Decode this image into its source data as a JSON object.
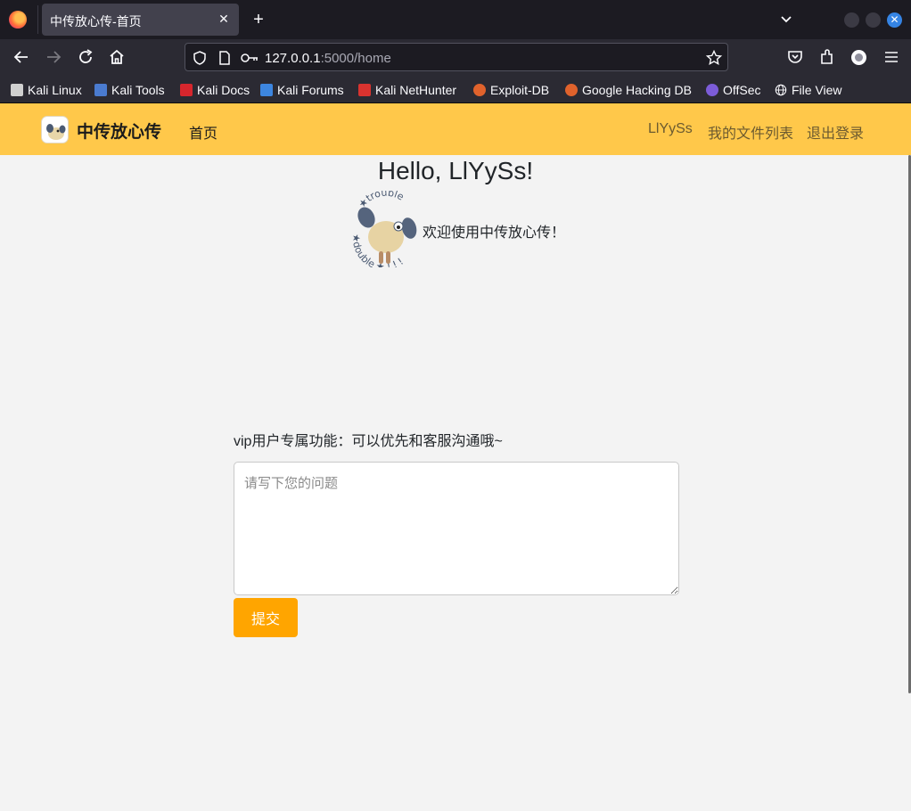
{
  "browser": {
    "tab_title": "中传放心传-首页",
    "url_host": "127.0.0.1",
    "url_path": ":5000/home",
    "bookmarks": [
      {
        "label": "Kali Linux",
        "color": "#367bf0"
      },
      {
        "label": "Kali Tools",
        "color": "#4a7bd0"
      },
      {
        "label": "Kali Docs",
        "color": "#d6262d"
      },
      {
        "label": "Kali Forums",
        "color": "#3d86e0"
      },
      {
        "label": "Kali NetHunter",
        "color": "#d9332f"
      },
      {
        "label": "Exploit-DB",
        "color": "#e0622c"
      },
      {
        "label": "Google Hacking DB",
        "color": "#e0622c"
      },
      {
        "label": "OffSec",
        "color": "#7c5cd8"
      },
      {
        "label": "File View",
        "color": "#fbfbfe"
      }
    ]
  },
  "header": {
    "brand": "中传放心传",
    "nav_home": "首页",
    "user": "LlYySs",
    "files": "我的文件列表",
    "logout": "退出登录",
    "bg_color": "#ffc84a"
  },
  "main": {
    "greeting": "Hello, LlYySs!",
    "welcome": "欢迎使用中传放心传！",
    "vip_label": "vip用户专属功能：可以优先和客服沟通哦~",
    "question_placeholder": "请写下您的问题",
    "question_value": "",
    "submit_label": "提交",
    "accent_color": "#ffa500"
  }
}
